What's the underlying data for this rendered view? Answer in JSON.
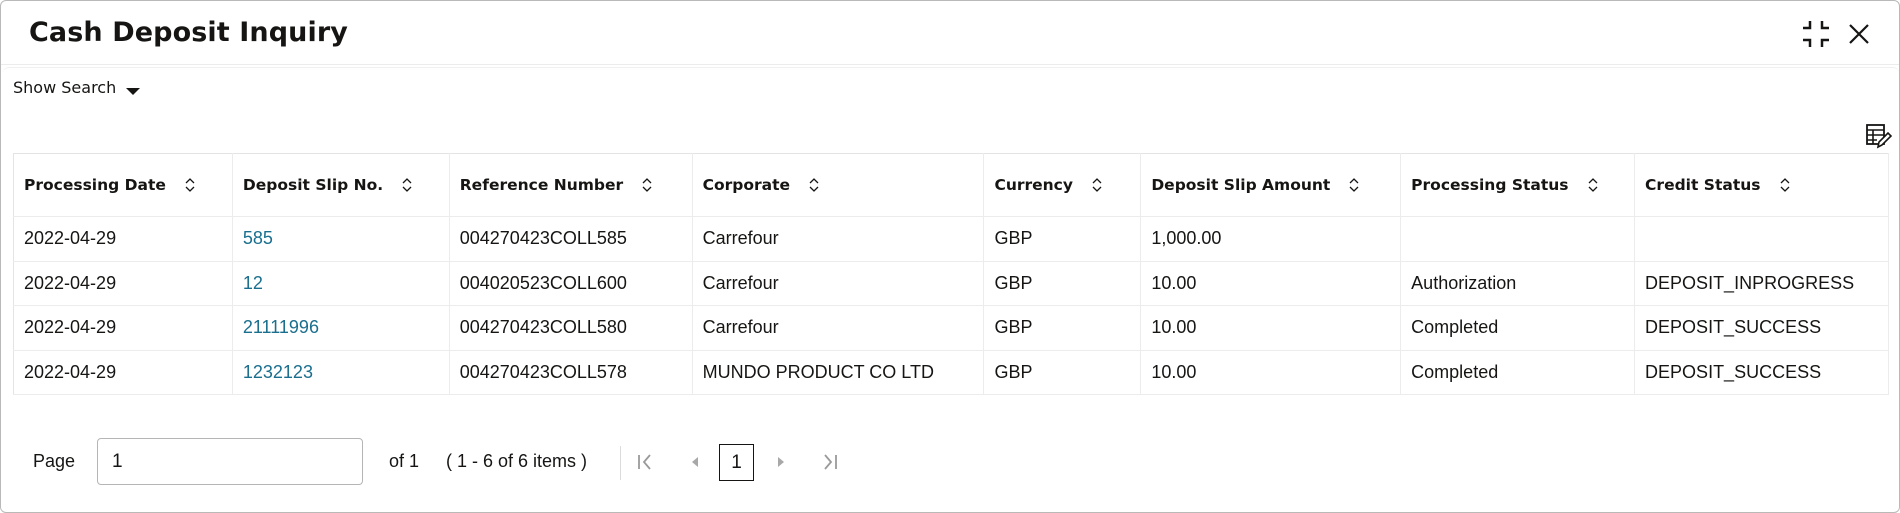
{
  "window": {
    "title": "Cash Deposit Inquiry",
    "minimize_icon": "exit-fullscreen-icon",
    "close_icon": "close-icon"
  },
  "toolbar": {
    "show_search_label": "Show Search",
    "show_search_icon": "caret-down-icon",
    "column_settings_icon": "table-edit-icon"
  },
  "table": {
    "columns": [
      {
        "label": "Processing Date"
      },
      {
        "label": "Deposit Slip No."
      },
      {
        "label": "Reference Number"
      },
      {
        "label": "Corporate"
      },
      {
        "label": "Currency"
      },
      {
        "label": "Deposit Slip Amount"
      },
      {
        "label": "Processing Status"
      },
      {
        "label": "Credit Status"
      }
    ],
    "rows": [
      {
        "processing_date": "2022-04-29",
        "deposit_slip_no": "585",
        "reference_number": "004270423COLL585",
        "corporate": "Carrefour",
        "currency": "GBP",
        "amount": "1,000.00",
        "processing_status": "",
        "credit_status": ""
      },
      {
        "processing_date": "2022-04-29",
        "deposit_slip_no": "12",
        "reference_number": "004020523COLL600",
        "corporate": "Carrefour",
        "currency": "GBP",
        "amount": "10.00",
        "processing_status": "Authorization",
        "credit_status": "DEPOSIT_INPROGRESS"
      },
      {
        "processing_date": "2022-04-29",
        "deposit_slip_no": "21111996",
        "reference_number": "004270423COLL580",
        "corporate": "Carrefour",
        "currency": "GBP",
        "amount": "10.00",
        "processing_status": "Completed",
        "credit_status": "DEPOSIT_SUCCESS"
      },
      {
        "processing_date": "2022-04-29",
        "deposit_slip_no": "1232123",
        "reference_number": "004270423COLL578",
        "corporate": "MUNDO PRODUCT CO LTD",
        "currency": "GBP",
        "amount": "10.00",
        "processing_status": "Completed",
        "credit_status": "DEPOSIT_SUCCESS"
      }
    ]
  },
  "pagination": {
    "page_label": "Page",
    "page_value": "1",
    "of_label": "of 1",
    "items_label": "( 1 - 6 of 6 items )",
    "current_page": "1"
  },
  "colors": {
    "link": "#1a6f8e",
    "text": "#161513",
    "border": "#ececec"
  }
}
